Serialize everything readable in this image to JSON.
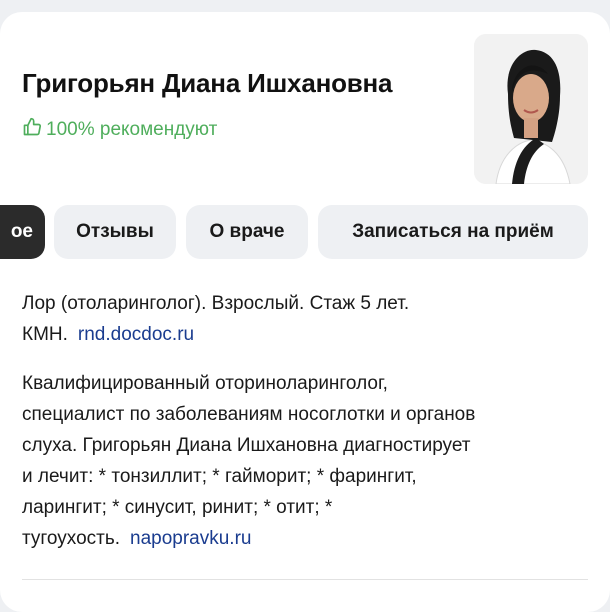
{
  "doctor": {
    "name": "Григорьян Диана Ишхановна",
    "recommend_text": "100% рекомендуют"
  },
  "tabs": [
    {
      "label": "ое",
      "active": true
    },
    {
      "label": "Отзывы",
      "active": false
    },
    {
      "label": "О враче",
      "active": false
    },
    {
      "label": "Записаться на приём",
      "active": false
    }
  ],
  "specialty": {
    "line1": "Лор (отоларинголог). Взрослый. Стаж 5 лет.",
    "line2": "КМН.",
    "source": "rnd.docdoc.ru"
  },
  "description": {
    "lines": [
      "Квалифицированный оториноларинголог,",
      "специалист по заболеваниям носоглотки и органов",
      "слуха. Григорьян Диана Ишхановна диагностирует",
      "и лечит: * тонзиллит; * гайморит; * фарингит,",
      "ларингит; * синусит, ринит; * отит; *",
      "тугоухость."
    ],
    "source": "napopravku.ru"
  },
  "colors": {
    "recommend_green": "#4fae5c",
    "link_blue": "#1a3c8f",
    "active_tab": "#2b2b2b",
    "tab_bg": "#eef0f3"
  },
  "icons": {
    "recommend": "thumbs-up-icon"
  }
}
